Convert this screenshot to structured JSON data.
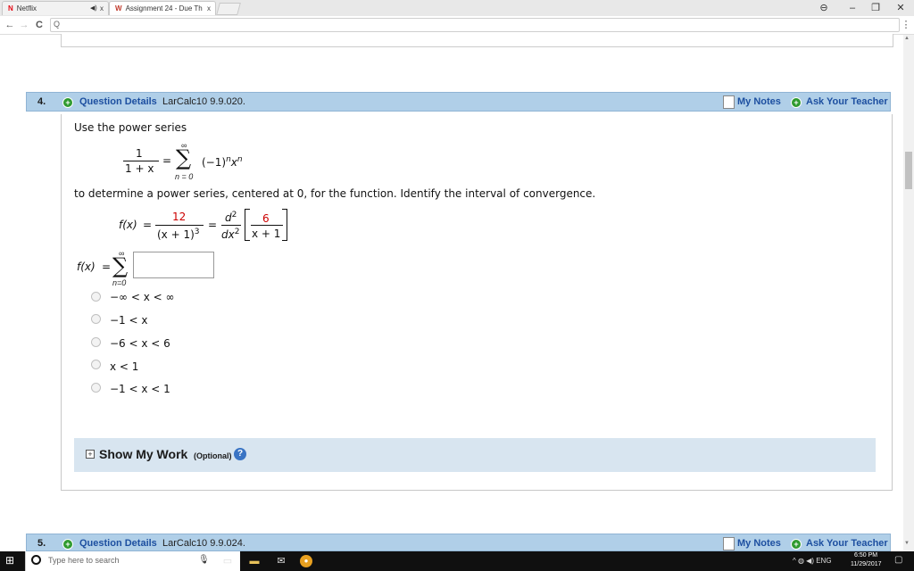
{
  "browser": {
    "tabs": [
      {
        "label": "Netflix",
        "icon": "N",
        "audio_icon": "◀)",
        "close": "x"
      },
      {
        "label": "Assignment 24 - Due Th",
        "icon": "W",
        "close": "x"
      }
    ],
    "window_controls": {
      "profile": "⊖",
      "minimize": "–",
      "restore": "❐",
      "close": "✕"
    },
    "nav": {
      "back": "←",
      "forward": "→",
      "reload": "C",
      "search_glyph": "Q",
      "menu": "⋮"
    }
  },
  "questions": [
    {
      "number": "4.",
      "details_label": "Question Details",
      "reference": "LarCalc10 9.9.020.",
      "my_notes": "My Notes",
      "ask_teacher": "Ask Your Teacher",
      "prompt": "Use the power series",
      "series": {
        "lhs_num": "1",
        "lhs_den": "1 + x",
        "equals": "=",
        "sigma_top": "∞",
        "sigma_bottom": "n = 0",
        "term": "(−1)",
        "exp_n": "n",
        "x": "x",
        "exp_n2": "n"
      },
      "instruction": "to determine a power series, centered at 0, for the function. Identify the interval of convergence.",
      "function": {
        "fx": "f(x)",
        "equals": "=",
        "num": "12",
        "den": "(x + 1)",
        "den_exp": "3",
        "equals2": "=",
        "d2": "d",
        "d2_exp": "2",
        "dx2": "dx",
        "dx2_exp": "2",
        "inner_num": "6",
        "inner_den": "x + 1"
      },
      "answer": {
        "fx": "f(x)",
        "equals": "=",
        "sigma_top": "∞",
        "sigma_bottom": "n=0",
        "value": ""
      },
      "options": [
        "−∞ < x < ∞",
        "−1 < x",
        "−6 < x < 6",
        "x < 1",
        "−1 < x < 1"
      ],
      "show_work": {
        "label": "Show My Work",
        "optional": "(Optional)",
        "help": "?",
        "expand": "+"
      }
    },
    {
      "number": "5.",
      "details_label": "Question Details",
      "reference": "LarCalc10 9.9.024.",
      "my_notes": "My Notes",
      "ask_teacher": "Ask Your Teacher"
    }
  ],
  "taskbar": {
    "search_placeholder": "Type here to search",
    "language": "ENG",
    "time": "6:50 PM",
    "date": "11/29/2017"
  },
  "colors": {
    "header_bg": "#b0cfe8",
    "link_blue": "#1d4fa0",
    "plus_green": "#2e9a2e",
    "answer_red": "#cc0000",
    "showwork_bg": "#d8e5f0"
  }
}
